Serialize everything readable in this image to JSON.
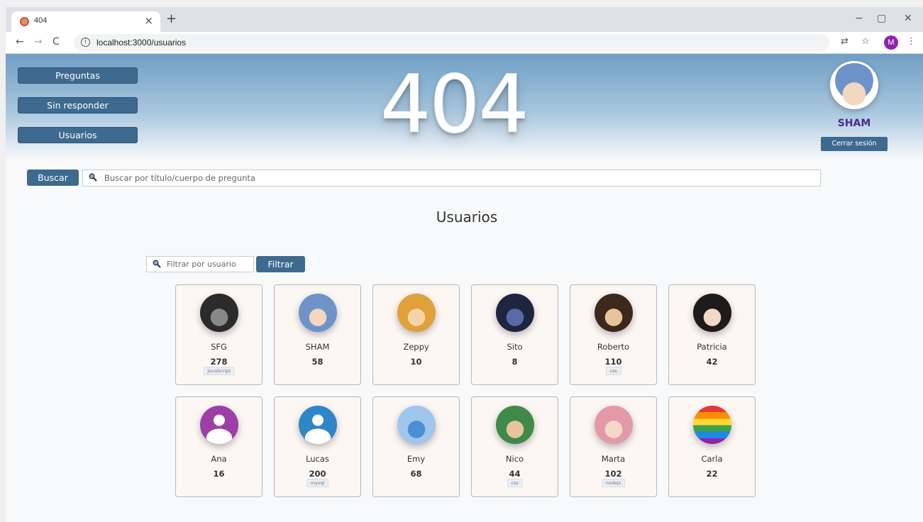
{
  "browser": {
    "tab_title": "404",
    "tab_close": "×",
    "new_tab": "+",
    "url": "localhost:3000/usuarios",
    "profile_initial": "M",
    "window_controls": [
      "−",
      "▢",
      "✕"
    ],
    "nav": [
      "←",
      "→",
      "C"
    ]
  },
  "sidebar": {
    "items": [
      {
        "label": "Preguntas"
      },
      {
        "label": "Sin responder"
      },
      {
        "label": "Usuarios"
      }
    ]
  },
  "header": {
    "logo_text": "404",
    "user_name": "SHAM",
    "logout_label": "Cerrar sesión"
  },
  "search": {
    "button_label": "Buscar",
    "placeholder": "Buscar por título/cuerpo de pregunta"
  },
  "main": {
    "title": "Usuarios",
    "filter_placeholder": "Filtrar por usuario",
    "filter_button": "Filtrar",
    "users": [
      {
        "name": "SFG",
        "count": "278",
        "tag": "JavaScript",
        "avatar_color": "#2b2b2b",
        "avatar_accent": "#888888"
      },
      {
        "name": "SHAM",
        "count": "58",
        "tag": "",
        "avatar_color": "#6d93c9",
        "avatar_accent": "#f3d7c1"
      },
      {
        "name": "Zeppy",
        "count": "10",
        "tag": "",
        "avatar_color": "#e0a03a",
        "avatar_accent": "#f6d3a8"
      },
      {
        "name": "Sito",
        "count": "8",
        "tag": "",
        "avatar_color": "#1e2540",
        "avatar_accent": "#5a6aa8"
      },
      {
        "name": "Roberto",
        "count": "110",
        "tag": "css",
        "avatar_color": "#3b2a1c",
        "avatar_accent": "#e7c49a"
      },
      {
        "name": "Patricia",
        "count": "42",
        "tag": "",
        "avatar_color": "#1c1c1c",
        "avatar_accent": "#f4d8c6"
      },
      {
        "name": "Ana",
        "count": "16",
        "tag": "",
        "avatar_color": "#9d3fa6",
        "avatar_accent": "#ffffff"
      },
      {
        "name": "Lucas",
        "count": "200",
        "tag": "mysql",
        "avatar_color": "#2e86c8",
        "avatar_accent": "#ffffff"
      },
      {
        "name": "Emy",
        "count": "68",
        "tag": "",
        "avatar_color": "#9fc6ec",
        "avatar_accent": "#4a8fd4"
      },
      {
        "name": "Nico",
        "count": "44",
        "tag": "css",
        "avatar_color": "#3f8a4a",
        "avatar_accent": "#e7c49a"
      },
      {
        "name": "Marta",
        "count": "102",
        "tag": "nodejs",
        "avatar_color": "#e39aa8",
        "avatar_accent": "#f6d8c8"
      },
      {
        "name": "Carla",
        "count": "22",
        "tag": "",
        "avatar_color": "rainbow",
        "avatar_accent": "#ffffff"
      }
    ]
  },
  "colors": {
    "accent": "#3e6a8f",
    "user_name": "#4a2c8c"
  }
}
